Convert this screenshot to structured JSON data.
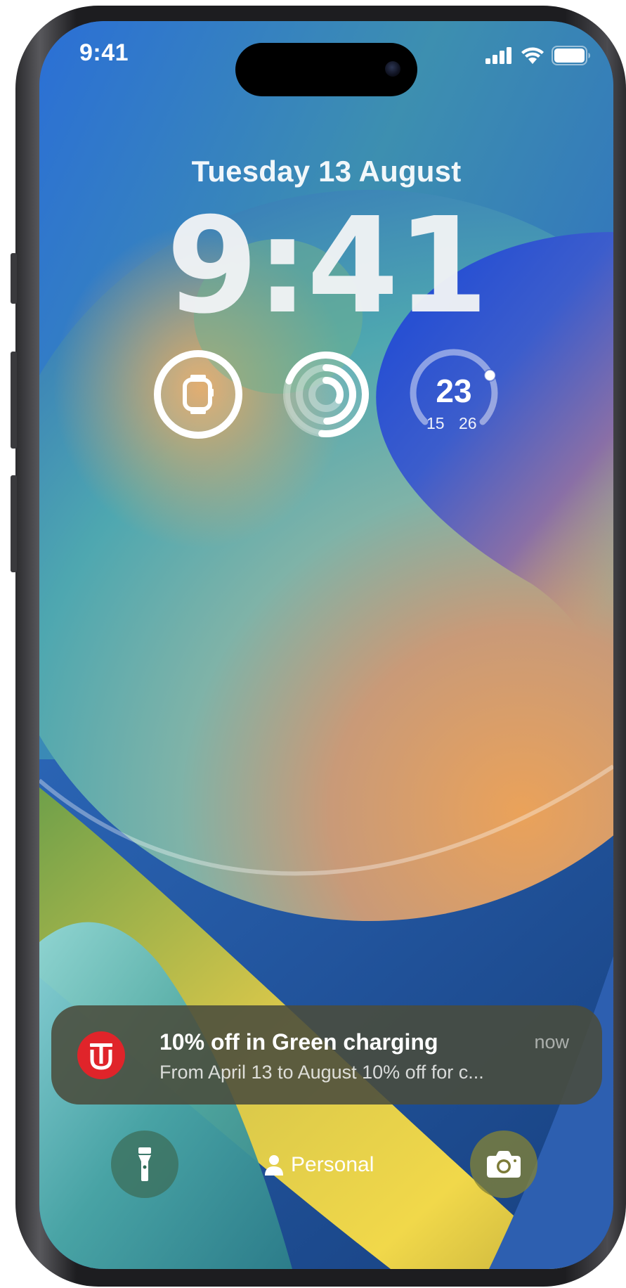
{
  "status_bar": {
    "time": "9:41",
    "signal_icon": "cellular-signal-icon",
    "wifi_icon": "wifi-icon",
    "battery_icon": "battery-full-icon"
  },
  "lock_screen": {
    "date": "Tuesday 13 August",
    "time": "9:41"
  },
  "widgets": {
    "watch_battery": {
      "icon": "apple-watch-icon",
      "level": 1.0
    },
    "activity": {
      "icon": "activity-rings-icon"
    },
    "temperature": {
      "current": "23",
      "low": "15",
      "high": "26",
      "position": 0.73
    }
  },
  "notification": {
    "app_icon": "app-logo-icon",
    "app_icon_color": "#e0242a",
    "title": "10% off in Green charging",
    "body": "From April 13 to August 10% off for c...",
    "time": "now"
  },
  "bottom_controls": {
    "flashlight_icon": "flashlight-icon",
    "focus_icon": "person-icon",
    "focus_label": "Personal",
    "camera_icon": "camera-icon"
  }
}
